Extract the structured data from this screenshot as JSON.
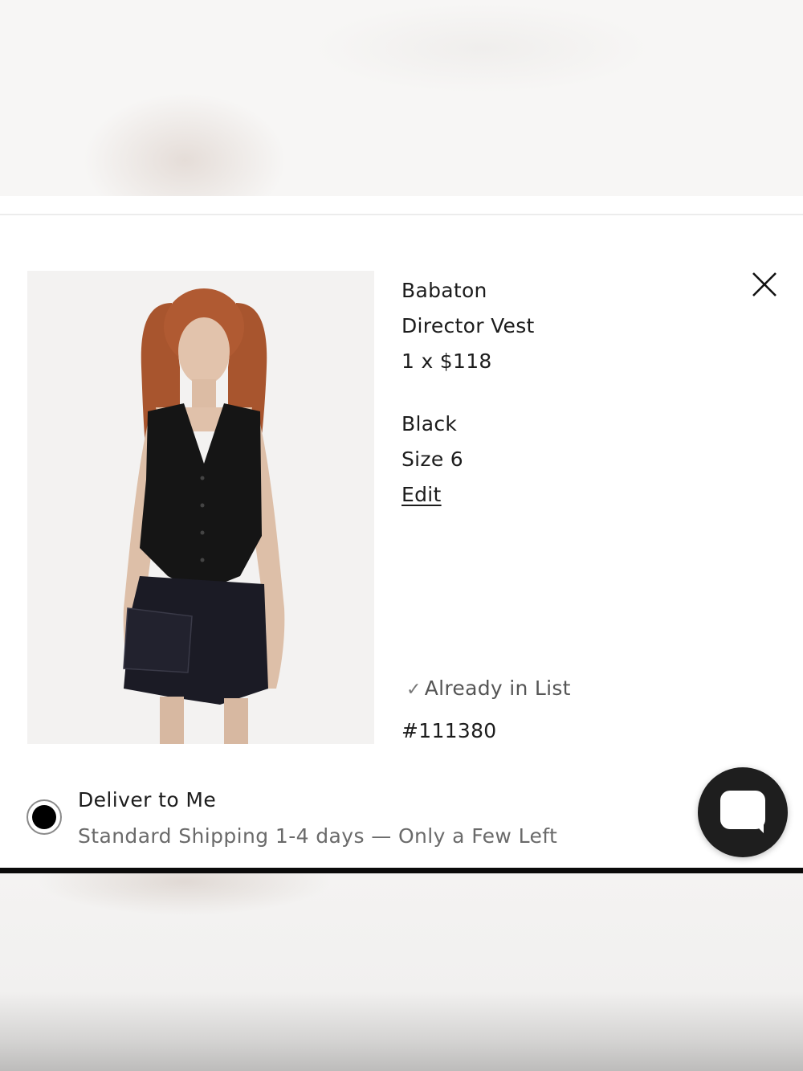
{
  "item": {
    "brand": "Babaton",
    "name": "Director Vest",
    "quantity_price": "1 x $118",
    "color": "Black",
    "size": "Size 6",
    "edit_label": "Edit",
    "list_status": "Already in List",
    "sku": "#111380"
  },
  "delivery": {
    "title": "Deliver to Me",
    "subtitle": "Standard Shipping 1-4 days — Only a Few Left",
    "selected": true
  },
  "icons": {
    "close": "close-icon",
    "check": "check-icon",
    "chat": "chat-icon"
  },
  "colors": {
    "accent": "#000000",
    "muted_text": "#6a6a6a"
  }
}
